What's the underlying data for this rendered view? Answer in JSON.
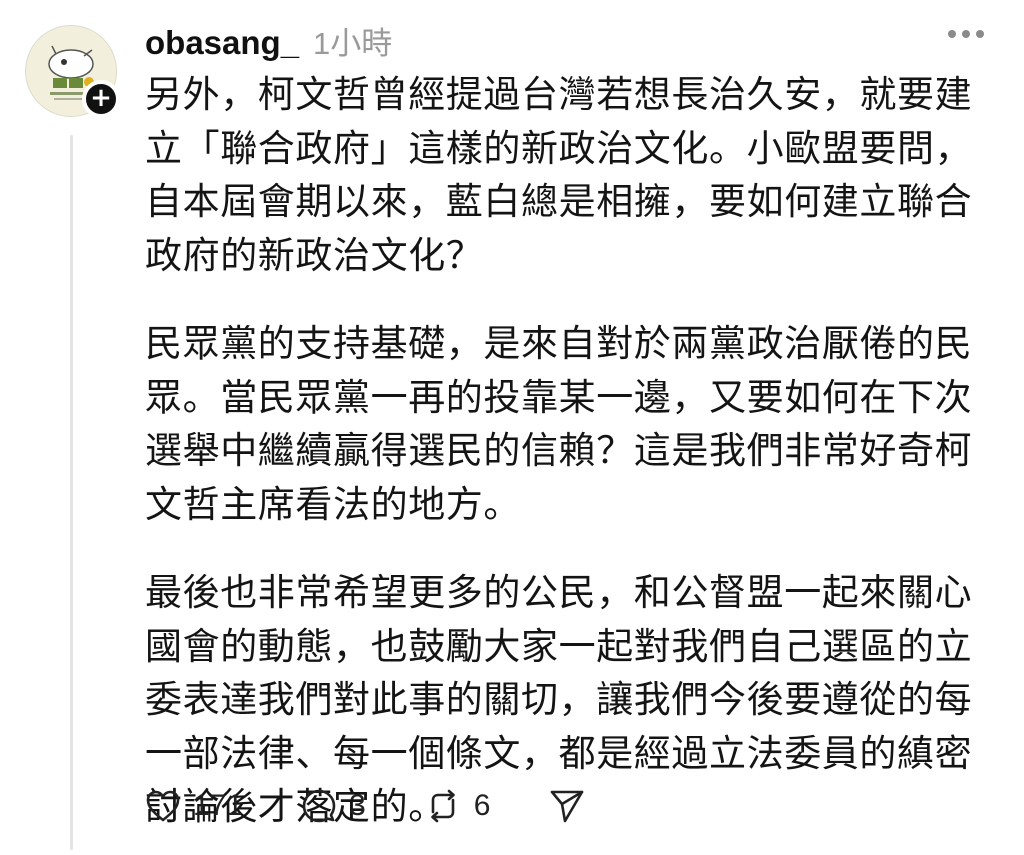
{
  "post": {
    "username": "obasang_",
    "timestamp": "1小時",
    "paragraphs": [
      "另外，柯文哲曾經提過台灣若想長治久安，就要建立「聯合政府」這樣的新政治文化。小歐盟要問，自本屆會期以來，藍白總是相擁，要如何建立聯合政府的新政治文化？",
      "民眾黨的支持基礎，是來自對於兩黨政治厭倦的民眾。當民眾黨一再的投靠某一邊，又要如何在下次選舉中繼續贏得選民的信賴？這是我們非常好奇柯文哲主席看法的地方。",
      "最後也非常希望更多的公民，和公督盟一起來關心國會的動態，也鼓勵大家一起對我們自己選區的立委表達我們對此事的關切，讓我們今後要遵從的每一部法律、每一個條文，都是經過立法委員的縝密討論後才落定的。"
    ]
  },
  "actions": {
    "like_count": "171",
    "comment_count": "3",
    "repost_count": "6"
  },
  "icons": {
    "more": "more-horizontal-icon",
    "like": "heart-icon",
    "comment": "speech-bubble-icon",
    "repost": "repost-icon",
    "share": "send-icon",
    "follow": "plus-icon"
  }
}
